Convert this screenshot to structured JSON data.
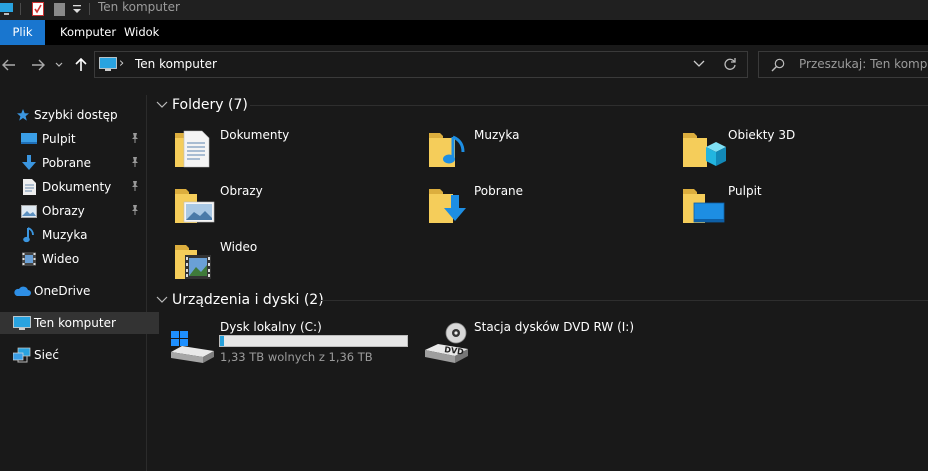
{
  "window": {
    "title": "Ten komputer"
  },
  "ribbon": {
    "tabs": [
      "Plik",
      "Komputer",
      "Widok"
    ]
  },
  "address": {
    "crumb": "Ten komputer"
  },
  "search": {
    "placeholder": "Przeszukaj: Ten komputer"
  },
  "sidebar": {
    "items": [
      {
        "label": "Szybki dostęp",
        "icon": "star-icon",
        "pinned": false
      },
      {
        "label": "Pulpit",
        "icon": "desktop-icon",
        "pinned": true
      },
      {
        "label": "Pobrane",
        "icon": "download-icon",
        "pinned": true
      },
      {
        "label": "Dokumenty",
        "icon": "document-icon",
        "pinned": true
      },
      {
        "label": "Obrazy",
        "icon": "picture-icon",
        "pinned": true
      },
      {
        "label": "Muzyka",
        "icon": "music-icon",
        "pinned": false
      },
      {
        "label": "Wideo",
        "icon": "video-icon",
        "pinned": false
      },
      {
        "label": "OneDrive",
        "icon": "cloud-icon",
        "pinned": false
      },
      {
        "label": "Ten komputer",
        "icon": "computer-icon",
        "pinned": false,
        "selected": true
      },
      {
        "label": "Sieć",
        "icon": "network-icon",
        "pinned": false
      }
    ]
  },
  "folders_section": {
    "title": "Foldery (7)",
    "items": [
      {
        "label": "Dokumenty",
        "icon": "documents-folder-icon"
      },
      {
        "label": "Muzyka",
        "icon": "music-folder-icon"
      },
      {
        "label": "Obiekty 3D",
        "icon": "3d-objects-folder-icon"
      },
      {
        "label": "Obrazy",
        "icon": "pictures-folder-icon"
      },
      {
        "label": "Pobrane",
        "icon": "downloads-folder-icon"
      },
      {
        "label": "Pulpit",
        "icon": "desktop-folder-icon"
      },
      {
        "label": "Wideo",
        "icon": "videos-folder-icon"
      }
    ]
  },
  "devices_section": {
    "title": "Urządzenia i dyski (2)",
    "items": [
      {
        "label": "Dysk lokalny (C:)",
        "free_text": "1,33 TB wolnych z 1,36 TB",
        "used_fraction": 0.022,
        "icon": "local-disk-icon"
      },
      {
        "label": "Stacja dysków DVD RW (I:)",
        "icon": "dvd-drive-icon"
      }
    ]
  },
  "colors": {
    "accent": "#1976cf",
    "background": "#191919",
    "drive_fill": "#26a0da",
    "folder": "#f5cd5a"
  }
}
